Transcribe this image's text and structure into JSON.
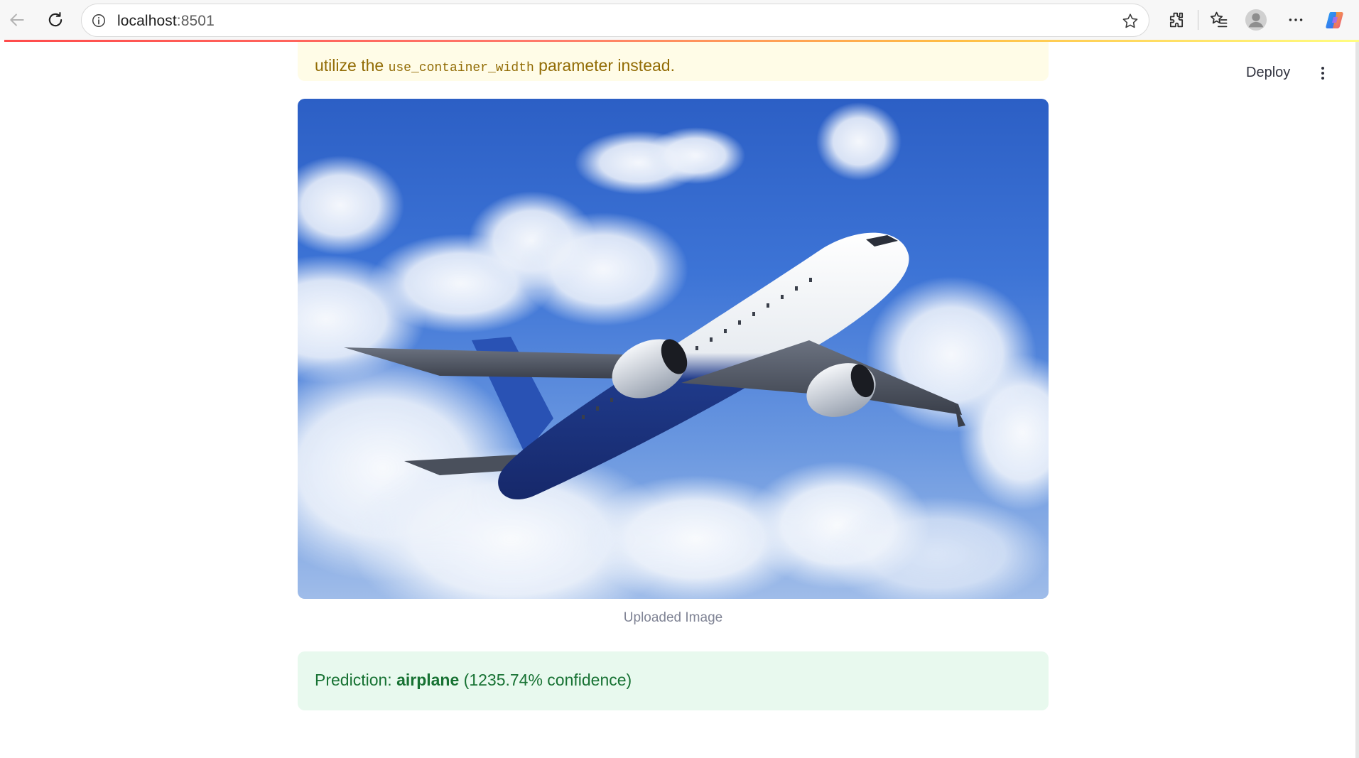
{
  "browser": {
    "url_host": "localhost",
    "url_port": ":8501"
  },
  "warning": {
    "text_before": "utilize the ",
    "code": "use_container_width",
    "text_after": " parameter instead."
  },
  "header": {
    "deploy_label": "Deploy"
  },
  "image": {
    "caption": "Uploaded Image"
  },
  "prediction": {
    "prefix": "Prediction: ",
    "label": "airplane",
    "confidence": " (1235.74% confidence)"
  },
  "colors": {
    "warning_bg": "#fffce7",
    "warning_text": "#926c05",
    "success_bg": "#e8f9ee",
    "success_text": "#177233",
    "accent": "#ff4b4b"
  },
  "icons": [
    "back-arrow-icon",
    "reload-icon",
    "info-icon",
    "star-icon",
    "extensions-icon",
    "favorites-icon",
    "profile-icon",
    "more-icon",
    "copilot-icon",
    "kebab-menu-icon"
  ]
}
